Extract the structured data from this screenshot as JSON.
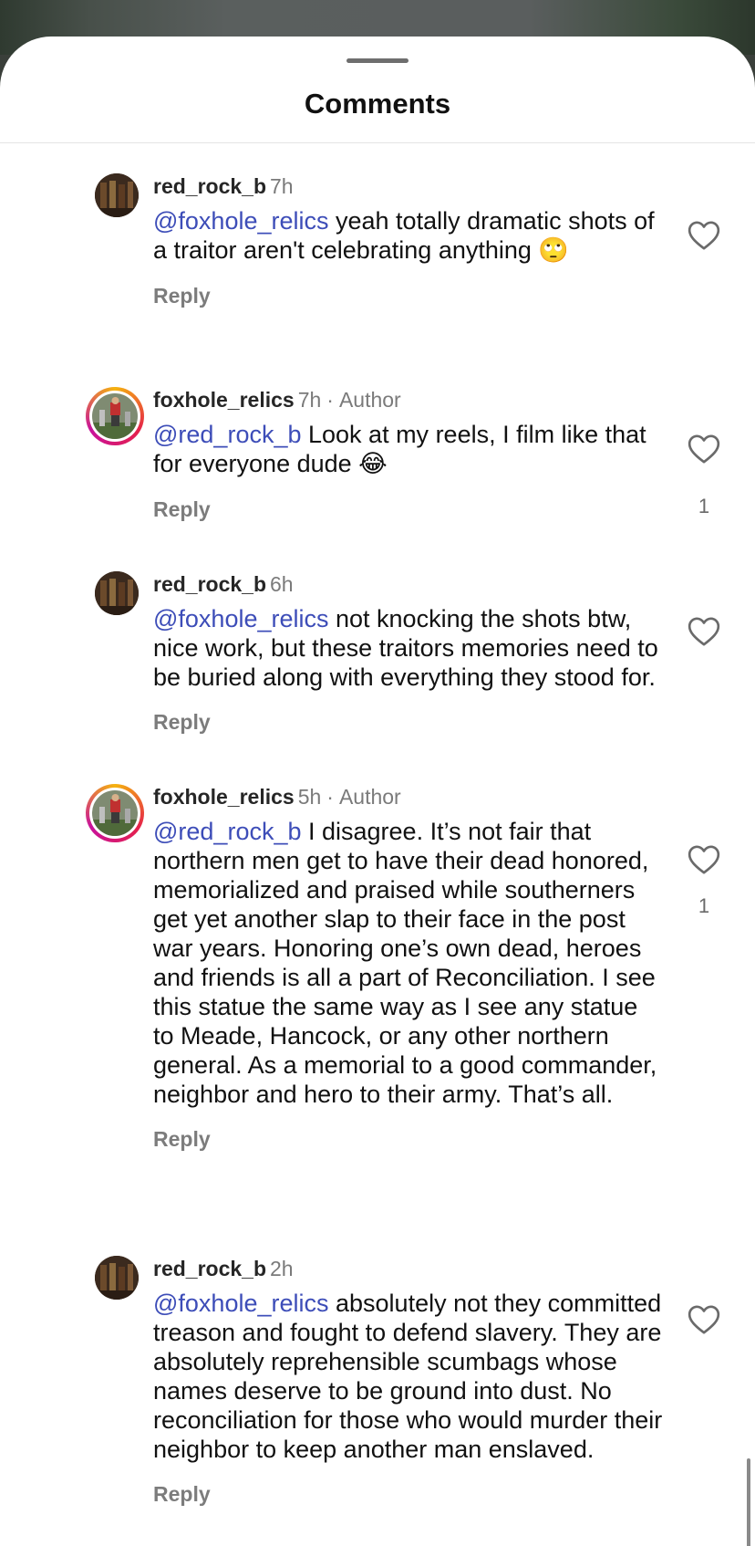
{
  "sheet": {
    "title": "Comments"
  },
  "comments": [
    {
      "username": "red_rock_b",
      "time": "7h",
      "mention": "@foxhole_relics",
      "text": " yeah totally dramatic shots of a traitor aren't celebrating anything ",
      "emoji": "🙄",
      "reply": "Reply",
      "likes": ""
    },
    {
      "username": "foxhole_relics",
      "time": "7h",
      "sep": "·",
      "badge": "Author",
      "mention": "@red_rock_b",
      "text": " Look at my reels, I film like that for everyone dude ",
      "emoji": "😂",
      "reply": "Reply",
      "likes": "1"
    },
    {
      "username": "red_rock_b",
      "time": "6h",
      "mention": "@foxhole_relics",
      "text": " not knocking the shots btw, nice work, but these traitors memories need to be buried along with everything they stood for.",
      "reply": "Reply",
      "likes": ""
    },
    {
      "username": "foxhole_relics",
      "time": "5h",
      "sep": "·",
      "badge": "Author",
      "mention": "@red_rock_b",
      "text": " I disagree. It’s not fair that northern men get to have their dead honored, memorialized and praised while southerners get yet another slap to their face in the post war years. Honoring one’s own dead, heroes and friends is all a part of Reconciliation. I see this statue the same way as I see any statue to Meade, Hancock, or any other northern general. As a memorial to a good commander, neighbor and hero to their army. That’s all.",
      "reply": "Reply",
      "likes": "1"
    },
    {
      "username": "red_rock_b",
      "time": "2h",
      "mention": "@foxhole_relics",
      "text": " absolutely not they committed treason and fought to defend slavery. They are absolutely reprehensible scumbags whose names deserve to be ground into dust. No reconciliation for those who would murder their neighbor to keep another man enslaved.",
      "reply": "Reply",
      "likes": ""
    }
  ],
  "colors": {
    "mention": "#3d4db8",
    "story_ring": "#e5214a"
  },
  "icons": {
    "like": "heart-outline-icon"
  }
}
